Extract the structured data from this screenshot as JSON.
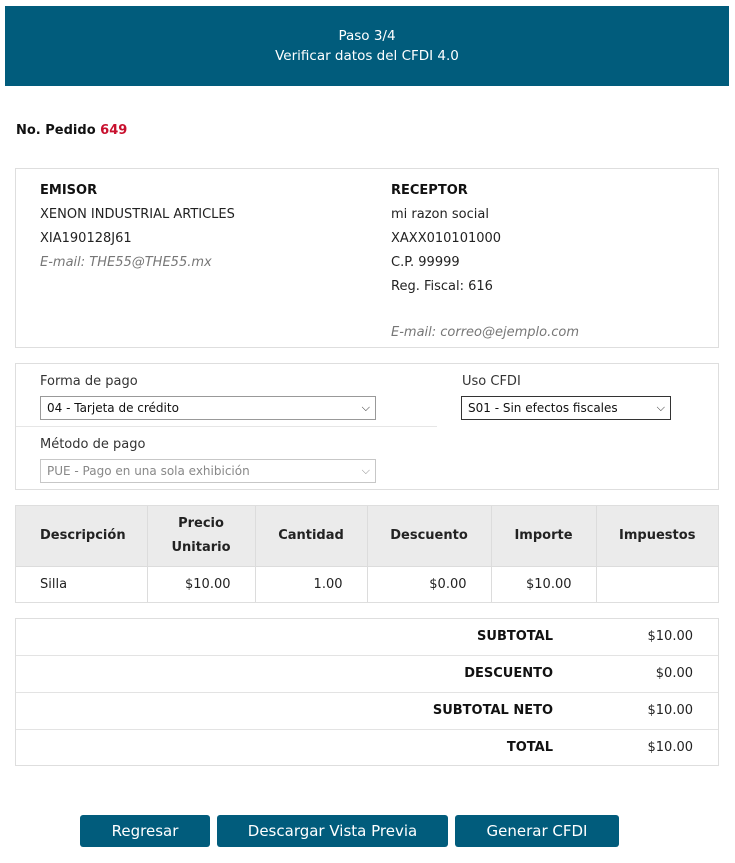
{
  "header": {
    "step": "Paso 3/4",
    "title": "Verificar datos del CFDI 4.0"
  },
  "order": {
    "label": "No. Pedido",
    "number": "649"
  },
  "emisor": {
    "title": "EMISOR",
    "name": "XENON INDUSTRIAL ARTICLES",
    "rfc": "XIA190128J61",
    "email": "E-mail: THE55@THE55.mx"
  },
  "receptor": {
    "title": "RECEPTOR",
    "name": "mi razon social",
    "rfc": "XAXX010101000",
    "cp": "C.P. 99999",
    "regimen": "Reg. Fiscal: 616",
    "email": "E-mail: correo@ejemplo.com"
  },
  "payment": {
    "forma_label": "Forma de pago",
    "forma_value": "04 - Tarjeta de crédito",
    "metodo_label": "Método de pago",
    "metodo_value": "PUE - Pago en una sola exhibición",
    "uso_label": "Uso CFDI",
    "uso_value": "S01 - Sin efectos fiscales"
  },
  "items_table": {
    "headers": [
      "Descripción",
      "Precio Unitario",
      "Cantidad",
      "Descuento",
      "Importe",
      "Impuestos"
    ],
    "rows": [
      {
        "descripcion": "Silla",
        "precio": "$10.00",
        "cantidad": "1.00",
        "descuento": "$0.00",
        "importe": "$10.00",
        "impuestos": ""
      }
    ]
  },
  "totals": [
    {
      "label": "SUBTOTAL",
      "value": "$10.00"
    },
    {
      "label": "DESCUENTO",
      "value": "$0.00"
    },
    {
      "label": "SUBTOTAL NETO",
      "value": "$10.00"
    },
    {
      "label": "TOTAL",
      "value": "$10.00"
    }
  ],
  "buttons": {
    "back": "Regresar",
    "preview": "Descargar Vista Previa",
    "generate": "Generar CFDI"
  },
  "colors": {
    "brand": "#015c7c",
    "order_number": "#c8102e"
  },
  "icons": {
    "select_arrow": "chevron-down-icon"
  }
}
